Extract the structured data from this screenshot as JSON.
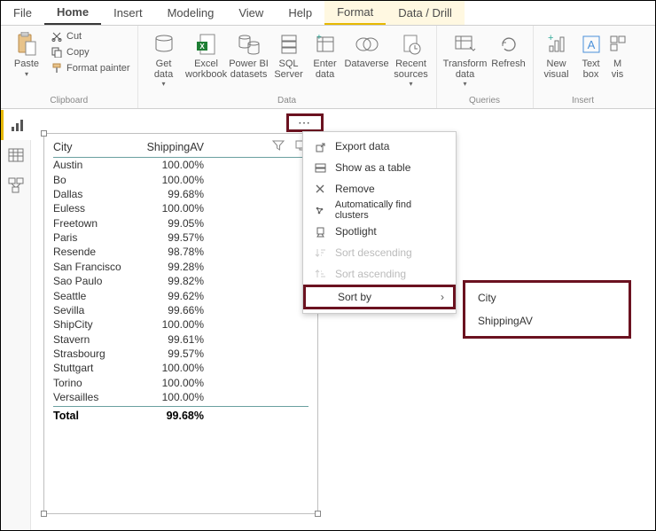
{
  "menu": {
    "file": "File",
    "home": "Home",
    "insert": "Insert",
    "modeling": "Modeling",
    "view": "View",
    "help": "Help",
    "format": "Format",
    "datadrill": "Data / Drill"
  },
  "ribbon": {
    "clipboard": {
      "label": "Clipboard",
      "paste": "Paste",
      "cut": "Cut",
      "copy": "Copy",
      "fmt": "Format painter"
    },
    "data": {
      "label": "Data",
      "get": "Get\ndata",
      "excel": "Excel\nworkbook",
      "pbi": "Power BI\ndatasets",
      "sql": "SQL\nServer",
      "enter": "Enter\ndata",
      "dv": "Dataverse",
      "recent": "Recent\nsources"
    },
    "queries": {
      "label": "Queries",
      "transform": "Transform\ndata",
      "refresh": "Refresh"
    },
    "insert": {
      "label": "Insert",
      "newvis": "New\nvisual",
      "textbox": "Text\nbox",
      "more": "M\nvis"
    }
  },
  "table": {
    "headers": {
      "c1": "City",
      "c2": "ShippingAV"
    },
    "rows": [
      {
        "c1": "Austin",
        "c2": "100.00%"
      },
      {
        "c1": "Bo",
        "c2": "100.00%"
      },
      {
        "c1": "Dallas",
        "c2": "99.68%"
      },
      {
        "c1": "Euless",
        "c2": "100.00%"
      },
      {
        "c1": "Freetown",
        "c2": "99.05%"
      },
      {
        "c1": "Paris",
        "c2": "99.57%"
      },
      {
        "c1": "Resende",
        "c2": "98.78%"
      },
      {
        "c1": "San Francisco",
        "c2": "99.28%"
      },
      {
        "c1": "Sao Paulo",
        "c2": "99.82%"
      },
      {
        "c1": "Seattle",
        "c2": "99.62%"
      },
      {
        "c1": "Sevilla",
        "c2": "99.66%"
      },
      {
        "c1": "ShipCity",
        "c2": "100.00%"
      },
      {
        "c1": "Stavern",
        "c2": "99.61%"
      },
      {
        "c1": "Strasbourg",
        "c2": "99.57%"
      },
      {
        "c1": "Stuttgart",
        "c2": "100.00%"
      },
      {
        "c1": "Torino",
        "c2": "100.00%"
      },
      {
        "c1": "Versailles",
        "c2": "100.00%"
      }
    ],
    "total": {
      "c1": "Total",
      "c2": "99.68%"
    }
  },
  "ctx": {
    "export": "Export data",
    "showtable": "Show as a table",
    "remove": "Remove",
    "clusters": "Automatically find clusters",
    "spotlight": "Spotlight",
    "sortdesc": "Sort descending",
    "sortasc": "Sort ascending",
    "sortby": "Sort by"
  },
  "sortby": {
    "city": "City",
    "shipping": "ShippingAV"
  },
  "moredots": "⋯"
}
